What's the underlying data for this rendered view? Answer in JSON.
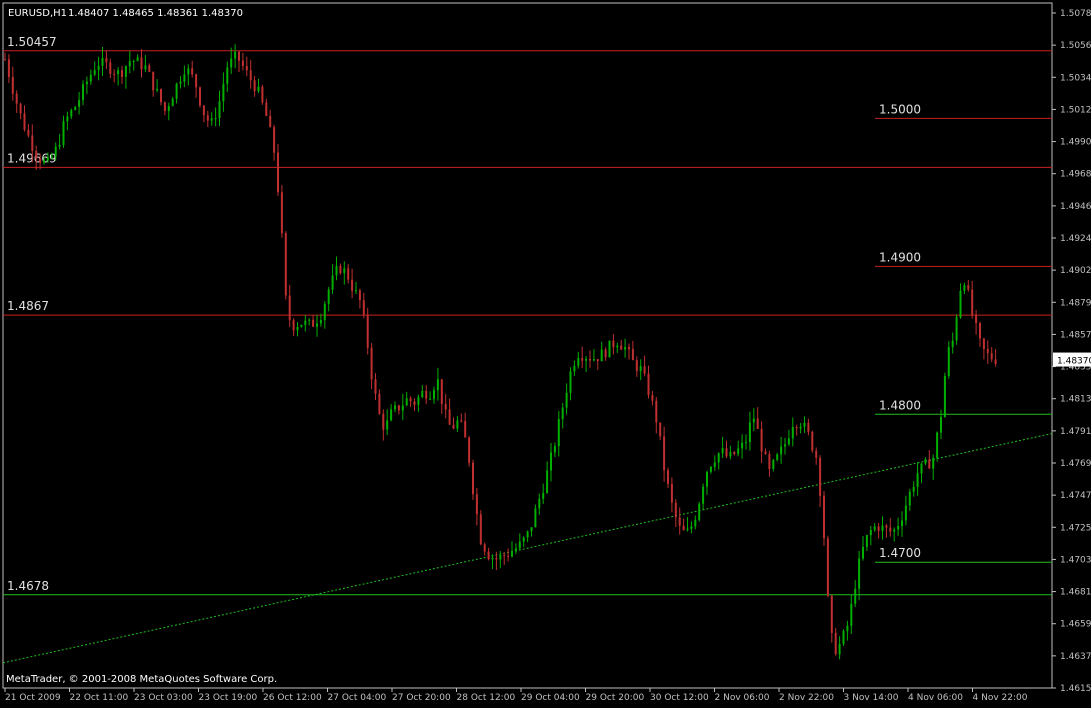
{
  "header": {
    "symbol": "EURUSD,H1",
    "quote": "1.48407 1.48465 1.48361 1.48370"
  },
  "footer": {
    "copyright": "MetaTrader, © 2001-2008 MetaQuotes Software Corp."
  },
  "colors": {
    "background": "#000000",
    "axis": "#c0c0c0",
    "bull": "#00b000",
    "bear": "#c03030",
    "resistance": "#c82020",
    "support": "#20c020",
    "trend": "#20c020"
  },
  "chart_data": {
    "type": "candlestick",
    "ylim": [
      1.4615,
      1.5078
    ],
    "price_ticks": [
      "1.50785",
      "1.50565",
      "1.50340",
      "1.50120",
      "1.49900",
      "1.49680",
      "1.49460",
      "1.49240",
      "1.49020",
      "1.48795",
      "1.48575",
      "1.48355",
      "1.48135",
      "1.47915",
      "1.47695",
      "1.47475",
      "1.47250",
      "1.47030",
      "1.46810",
      "1.46590",
      "1.46370",
      "1.46150"
    ],
    "current_price_label": "1.48370",
    "current_price": 1.4837,
    "time_ticks": [
      "21 Oct 2009",
      "22 Oct 11:00",
      "23 Oct 03:00",
      "23 Oct 19:00",
      "26 Oct 12:00",
      "27 Oct 04:00",
      "27 Oct 20:00",
      "28 Oct 12:00",
      "29 Oct 04:00",
      "29 Oct 20:00",
      "30 Oct 12:00",
      "2 Nov 06:00",
      "2 Nov 22:00",
      "3 Nov 14:00",
      "4 Nov 06:00",
      "4 Nov 22:00"
    ],
    "levels": [
      {
        "label": "1.50457",
        "price": 1.50457,
        "kind": "resistance",
        "span": "full"
      },
      {
        "label": "1.49669",
        "price": 1.49669,
        "kind": "resistance",
        "span": "full"
      },
      {
        "label": "1.4867",
        "price": 1.4867,
        "kind": "resistance",
        "span": "full"
      },
      {
        "label": "1.4678",
        "price": 1.4678,
        "kind": "support",
        "span": "full"
      },
      {
        "label": "1.5000",
        "price": 1.5,
        "kind": "resistance",
        "span": "right"
      },
      {
        "label": "1.4900",
        "price": 1.49,
        "kind": "resistance",
        "span": "right"
      },
      {
        "label": "1.4800",
        "price": 1.48,
        "kind": "support",
        "span": "right"
      },
      {
        "label": "1.4700",
        "price": 1.47,
        "kind": "support",
        "span": "right"
      }
    ],
    "trendline": {
      "style": "dotted",
      "start_price": 1.4632,
      "end_price": 1.4787
    },
    "price_path": [
      [
        0,
        1.504
      ],
      [
        8,
        1.502
      ],
      [
        14,
        1.5005
      ],
      [
        22,
        1.499
      ],
      [
        32,
        1.4975
      ],
      [
        42,
        1.4968
      ],
      [
        52,
        1.498
      ],
      [
        60,
        1.4998
      ],
      [
        72,
        1.501
      ],
      [
        82,
        1.5025
      ],
      [
        92,
        1.5038
      ],
      [
        104,
        1.5035
      ],
      [
        114,
        1.503
      ],
      [
        126,
        1.504
      ],
      [
        140,
        1.5035
      ],
      [
        150,
        1.502
      ],
      [
        160,
        1.5005
      ],
      [
        170,
        1.502
      ],
      [
        180,
        1.5035
      ],
      [
        190,
        1.5025
      ],
      [
        198,
        1.5005
      ],
      [
        206,
        1.4995
      ],
      [
        214,
        1.501
      ],
      [
        222,
        1.5035
      ],
      [
        232,
        1.5042
      ],
      [
        242,
        1.503
      ],
      [
        252,
        1.502
      ],
      [
        262,
        1.5
      ],
      [
        270,
        1.4975
      ],
      [
        276,
        1.493
      ],
      [
        280,
        1.488
      ],
      [
        286,
        1.486
      ],
      [
        296,
        1.4862
      ],
      [
        306,
        1.486
      ],
      [
        316,
        1.4868
      ],
      [
        324,
        1.4885
      ],
      [
        334,
        1.49
      ],
      [
        342,
        1.4895
      ],
      [
        348,
        1.4885
      ],
      [
        356,
        1.4875
      ],
      [
        362,
        1.485
      ],
      [
        368,
        1.482
      ],
      [
        374,
        1.48
      ],
      [
        380,
        1.479
      ],
      [
        386,
        1.48
      ],
      [
        394,
        1.4805
      ],
      [
        402,
        1.481
      ],
      [
        410,
        1.4808
      ],
      [
        418,
        1.4815
      ],
      [
        426,
        1.4815
      ],
      [
        432,
        1.4825
      ],
      [
        440,
        1.48
      ],
      [
        446,
        1.479
      ],
      [
        452,
        1.4795
      ],
      [
        458,
        1.479
      ],
      [
        464,
        1.477
      ],
      [
        470,
        1.474
      ],
      [
        476,
        1.4715
      ],
      [
        484,
        1.4705
      ],
      [
        492,
        1.4702
      ],
      [
        500,
        1.4705
      ],
      [
        508,
        1.4708
      ],
      [
        516,
        1.4712
      ],
      [
        524,
        1.472
      ],
      [
        532,
        1.4738
      ],
      [
        540,
        1.4755
      ],
      [
        548,
        1.4775
      ],
      [
        556,
        1.48
      ],
      [
        564,
        1.4825
      ],
      [
        572,
        1.4842
      ],
      [
        580,
        1.484
      ],
      [
        588,
        1.4838
      ],
      [
        596,
        1.484
      ],
      [
        604,
        1.4845
      ],
      [
        612,
        1.485
      ],
      [
        620,
        1.4845
      ],
      [
        628,
        1.4835
      ],
      [
        636,
        1.483
      ],
      [
        644,
        1.4815
      ],
      [
        652,
        1.4795
      ],
      [
        660,
        1.476
      ],
      [
        668,
        1.4735
      ],
      [
        676,
        1.472
      ],
      [
        684,
        1.472
      ],
      [
        692,
        1.4735
      ],
      [
        700,
        1.476
      ],
      [
        708,
        1.477
      ],
      [
        716,
        1.4775
      ],
      [
        724,
        1.477
      ],
      [
        732,
        1.4775
      ],
      [
        740,
        1.478
      ],
      [
        748,
        1.48
      ],
      [
        756,
        1.478
      ],
      [
        764,
        1.476
      ],
      [
        772,
        1.477
      ],
      [
        780,
        1.478
      ],
      [
        788,
        1.4795
      ],
      [
        796,
        1.4795
      ],
      [
        804,
        1.4785
      ],
      [
        812,
        1.477
      ],
      [
        818,
        1.473
      ],
      [
        822,
        1.468
      ],
      [
        828,
        1.464
      ],
      [
        836,
        1.4645
      ],
      [
        844,
        1.466
      ],
      [
        850,
        1.4685
      ],
      [
        856,
        1.4705
      ],
      [
        864,
        1.472
      ],
      [
        872,
        1.4725
      ],
      [
        880,
        1.4722
      ],
      [
        888,
        1.472
      ],
      [
        896,
        1.473
      ],
      [
        904,
        1.4745
      ],
      [
        912,
        1.476
      ],
      [
        920,
        1.4765
      ],
      [
        928,
        1.477
      ],
      [
        936,
        1.48
      ],
      [
        942,
        1.484
      ],
      [
        948,
        1.485
      ],
      [
        954,
        1.488
      ],
      [
        958,
        1.4895
      ],
      [
        962,
        1.4885
      ],
      [
        966,
        1.487
      ],
      [
        970,
        1.486
      ],
      [
        976,
        1.4845
      ],
      [
        982,
        1.484
      ],
      [
        988,
        1.4838
      ],
      [
        994,
        1.4837
      ]
    ]
  }
}
